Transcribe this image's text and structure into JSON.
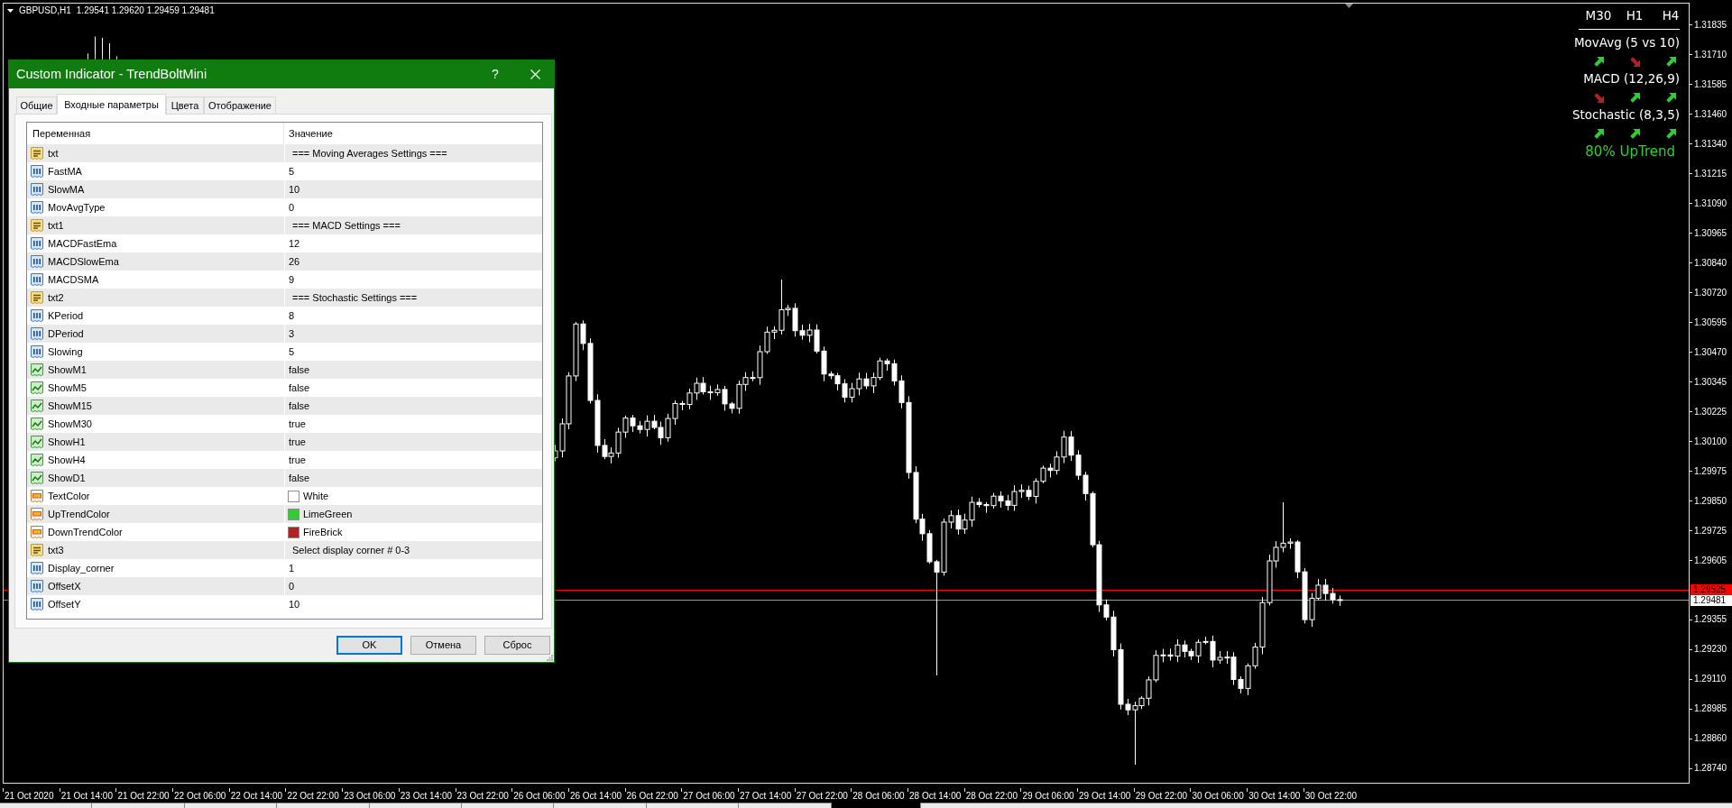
{
  "chart": {
    "symbol": "GBPUSD,H1",
    "ohlc": "1.29541 1.29620 1.29459 1.29481"
  },
  "indicator_panel": {
    "timeframes": [
      "M30",
      "H1",
      "H4"
    ],
    "rows": [
      {
        "label": "MovAvg (5 vs 10)",
        "signals": [
          {
            "kind": "up",
            "color": "#32cd32"
          },
          {
            "kind": "down",
            "color": "#b22222"
          },
          {
            "kind": "up",
            "color": "#32cd32"
          }
        ]
      },
      {
        "label": "MACD (12,26,9)",
        "signals": [
          {
            "kind": "down",
            "color": "#b22222"
          },
          {
            "kind": "up",
            "color": "#32cd32"
          },
          {
            "kind": "up",
            "color": "#32cd32"
          }
        ]
      },
      {
        "label": "Stochastic (8,3,5)",
        "signals": [
          {
            "kind": "up",
            "color": "#32cd32"
          },
          {
            "kind": "up",
            "color": "#32cd32"
          },
          {
            "kind": "up",
            "color": "#32cd32"
          }
        ]
      }
    ],
    "summary": "80% UpTrend"
  },
  "price_axis": {
    "labels": [
      "1.31835",
      "1.31710",
      "1.31585",
      "1.31460",
      "1.31340",
      "1.31215",
      "1.31090",
      "1.30965",
      "1.30840",
      "1.30720",
      "1.30595",
      "1.30470",
      "1.30345",
      "1.30225",
      "1.30100",
      "1.29975",
      "1.29850",
      "1.29725",
      "1.29605",
      "1.29355",
      "1.29230",
      "1.29110",
      "1.28985",
      "1.28860",
      "1.28740"
    ],
    "ask_tag": "1.29525",
    "bid_tag": "1.29481"
  },
  "time_axis": {
    "labels": [
      "21 Oct 2020",
      "21 Oct 14:00",
      "21 Oct 22:00",
      "22 Oct 06:00",
      "22 Oct 14:00",
      "22 Oct 22:00",
      "23 Oct 06:00",
      "23 Oct 14:00",
      "23 Oct 22:00",
      "26 Oct 06:00",
      "26 Oct 14:00",
      "26 Oct 22:00",
      "27 Oct 06:00",
      "27 Oct 14:00",
      "27 Oct 22:00",
      "28 Oct 06:00",
      "28 Oct 14:00",
      "28 Oct 22:00",
      "29 Oct 06:00",
      "29 Oct 14:00",
      "29 Oct 22:00",
      "30 Oct 06:00",
      "30 Oct 14:00",
      "30 Oct 22:00"
    ]
  },
  "dialog": {
    "title": "Custom Indicator - TrendBoltMini",
    "help": "?",
    "tabs": [
      {
        "label": "Общие",
        "selected": false
      },
      {
        "label": "Входные параметры",
        "selected": true
      },
      {
        "label": "Цвета",
        "selected": false
      },
      {
        "label": "Отображение",
        "selected": false
      }
    ],
    "table": {
      "columns": [
        "Переменная",
        "Значение"
      ],
      "rows": [
        {
          "kind": "string",
          "name": "txt",
          "value": "=== Moving Averages Settings ==="
        },
        {
          "kind": "int",
          "name": "FastMA",
          "value": "5"
        },
        {
          "kind": "int",
          "name": "SlowMA",
          "value": "10"
        },
        {
          "kind": "int",
          "name": "MovAvgType",
          "value": "0"
        },
        {
          "kind": "string",
          "name": "txt1",
          "value": "=== MACD Settings ==="
        },
        {
          "kind": "int",
          "name": "MACDFastEma",
          "value": "12"
        },
        {
          "kind": "int",
          "name": "MACDSlowEma",
          "value": "26"
        },
        {
          "kind": "int",
          "name": "MACDSMA",
          "value": "9"
        },
        {
          "kind": "string",
          "name": "txt2",
          "value": "=== Stochastic Settings ==="
        },
        {
          "kind": "int",
          "name": "KPeriod",
          "value": "8"
        },
        {
          "kind": "int",
          "name": "DPeriod",
          "value": "3"
        },
        {
          "kind": "int",
          "name": "Slowing",
          "value": "5"
        },
        {
          "kind": "bool",
          "name": "ShowM1",
          "value": "false"
        },
        {
          "kind": "bool",
          "name": "ShowM5",
          "value": "false"
        },
        {
          "kind": "bool",
          "name": "ShowM15",
          "value": "false"
        },
        {
          "kind": "bool",
          "name": "ShowM30",
          "value": "true"
        },
        {
          "kind": "bool",
          "name": "ShowH1",
          "value": "true"
        },
        {
          "kind": "bool",
          "name": "ShowH4",
          "value": "true"
        },
        {
          "kind": "bool",
          "name": "ShowD1",
          "value": "false"
        },
        {
          "kind": "color",
          "name": "TextColor",
          "value": "White",
          "color": "#ffffff"
        },
        {
          "kind": "color",
          "name": "UpTrendColor",
          "value": "LimeGreen",
          "color": "#32cd32"
        },
        {
          "kind": "color",
          "name": "DownTrendColor",
          "value": "FireBrick",
          "color": "#b22222"
        },
        {
          "kind": "string",
          "name": "txt3",
          "value": "Select display corner # 0-3"
        },
        {
          "kind": "int",
          "name": "Display_corner",
          "value": "1"
        },
        {
          "kind": "int",
          "name": "OffsetX",
          "value": "0"
        },
        {
          "kind": "int",
          "name": "OffsetY",
          "value": "10"
        }
      ]
    },
    "buttons": [
      {
        "label": "OK",
        "default": true
      },
      {
        "label": "Отмена",
        "default": false
      },
      {
        "label": "Сброс",
        "default": false
      }
    ]
  }
}
